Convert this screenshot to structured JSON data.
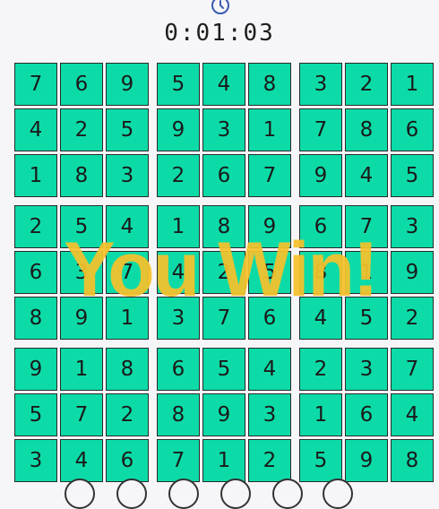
{
  "timer": {
    "value": "0:01:03",
    "icon": "clock-icon"
  },
  "overlay": {
    "text": "You Win!"
  },
  "colors": {
    "cell": "#0cdba8",
    "win_text": "#f6c22c"
  },
  "grid": [
    [
      7,
      6,
      9,
      5,
      4,
      8,
      3,
      2,
      1
    ],
    [
      4,
      2,
      5,
      9,
      3,
      1,
      7,
      8,
      6
    ],
    [
      1,
      8,
      3,
      2,
      6,
      7,
      9,
      4,
      5
    ],
    [
      2,
      5,
      4,
      1,
      8,
      9,
      6,
      7,
      3
    ],
    [
      6,
      3,
      7,
      4,
      2,
      5,
      8,
      1,
      9
    ],
    [
      8,
      9,
      1,
      3,
      7,
      6,
      4,
      5,
      2
    ],
    [
      9,
      1,
      8,
      6,
      5,
      4,
      2,
      3,
      7
    ],
    [
      5,
      7,
      2,
      8,
      9,
      3,
      1,
      6,
      4
    ],
    [
      3,
      4,
      6,
      7,
      1,
      2,
      5,
      9,
      8
    ]
  ]
}
